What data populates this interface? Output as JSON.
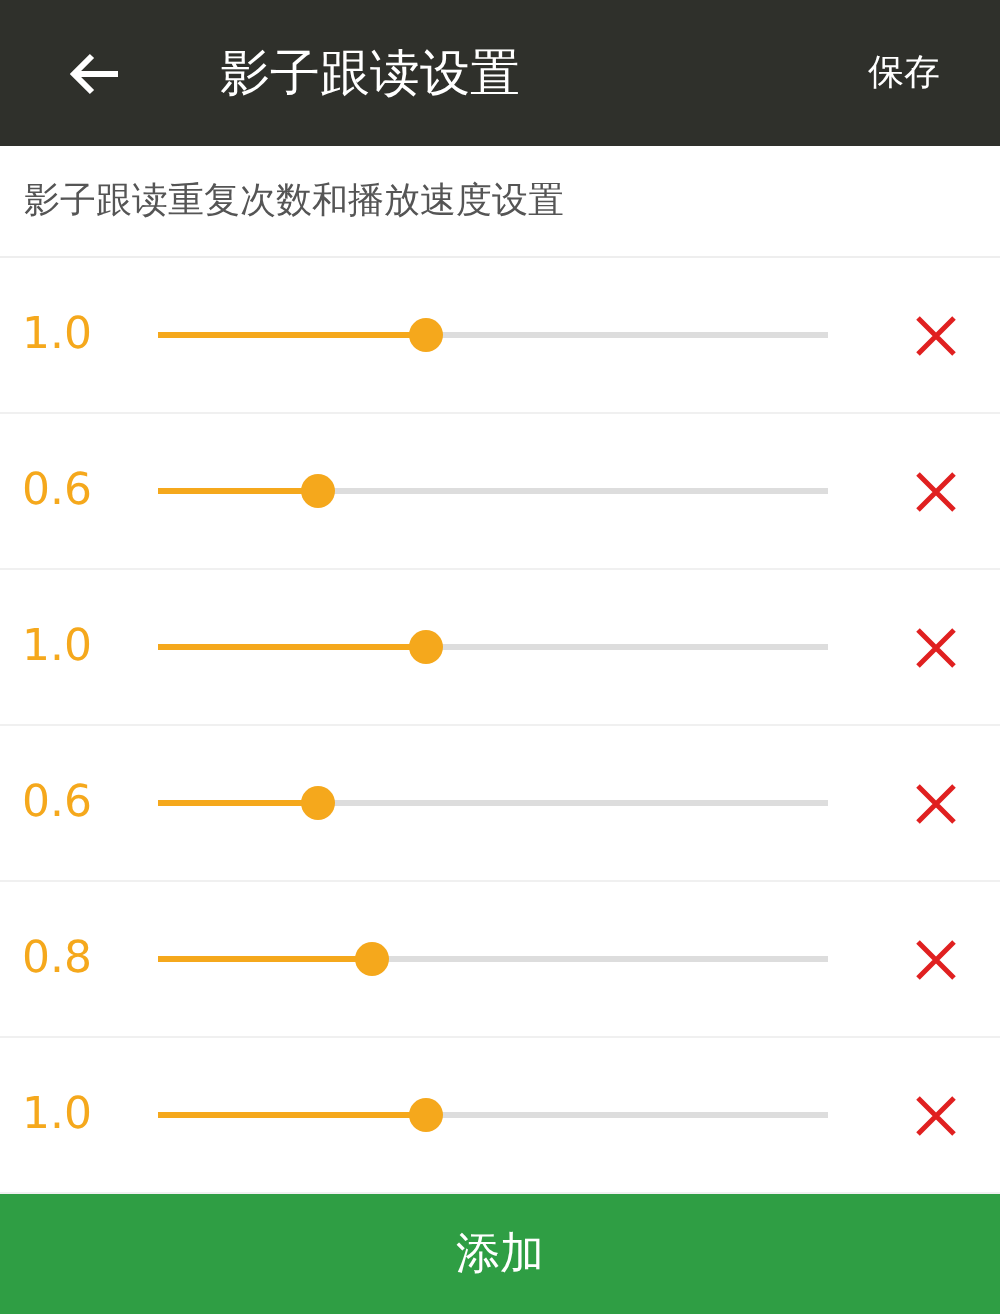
{
  "header": {
    "title": "影子跟读设置",
    "save": "保存"
  },
  "subtitle": "影子跟读重复次数和播放速度设置",
  "rows": [
    {
      "value": "1.0",
      "level": 0.4
    },
    {
      "value": "0.6",
      "level": 0.24
    },
    {
      "value": "1.0",
      "level": 0.4
    },
    {
      "value": "0.6",
      "level": 0.24
    },
    {
      "value": "0.8",
      "level": 0.32
    },
    {
      "value": "1.0",
      "level": 0.4
    }
  ],
  "add_button": "添加"
}
